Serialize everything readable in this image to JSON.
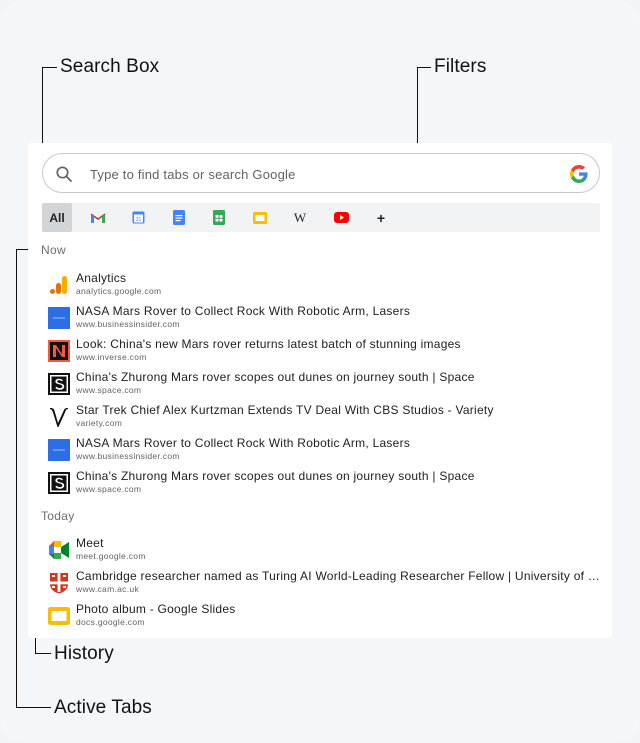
{
  "callouts": {
    "search_box": "Search Box",
    "filters": "Filters",
    "history": "History",
    "active_tabs": "Active Tabs"
  },
  "search": {
    "placeholder": "Type to find tabs or search Google"
  },
  "filters": {
    "all_label": "All",
    "add_label": "+",
    "wikipedia_letter": "W",
    "chips": [
      "gmail-icon",
      "calendar-icon",
      "docs-icon",
      "sheets-icon",
      "slides-icon",
      "wikipedia-icon",
      "youtube-icon"
    ]
  },
  "sections": {
    "now": "Now",
    "today": "Today"
  },
  "now_items": [
    {
      "title": "Analytics",
      "url": "analytics.google.com",
      "icon": "analytics-icon"
    },
    {
      "title": "NASA Mars Rover to Collect Rock With Robotic Arm, Lasers",
      "url": "www.businessinsider.com",
      "icon": "business-insider-icon"
    },
    {
      "title": "Look: China's new Mars rover returns latest batch of stunning images",
      "url": "www.inverse.com",
      "icon": "inverse-icon"
    },
    {
      "title": "China's Zhurong Mars rover scopes out dunes on journey south | Space",
      "url": "www.space.com",
      "icon": "space-icon"
    },
    {
      "title": "Star Trek Chief Alex Kurtzman Extends TV Deal With CBS Studios - Variety",
      "url": "variety.com",
      "icon": "variety-icon"
    },
    {
      "title": "NASA Mars Rover to Collect Rock With Robotic Arm, Lasers",
      "url": "www.businessinsider.com",
      "icon": "business-insider-icon"
    },
    {
      "title": "China's Zhurong Mars rover scopes out dunes on journey south | Space",
      "url": "www.space.com",
      "icon": "space-icon"
    }
  ],
  "today_items": [
    {
      "title": "Meet",
      "url": "meet.google.com",
      "icon": "meet-icon"
    },
    {
      "title": "Cambridge researcher named as Turing AI World-Leading Researcher Fellow | University of Cambridge",
      "url": "www.cam.ac.uk",
      "icon": "cambridge-icon"
    },
    {
      "title": "Photo album - Google Slides",
      "url": "docs.google.com",
      "icon": "slides-icon"
    }
  ],
  "colors": {
    "background": "#f3f7fa",
    "panel": "#ffffff",
    "filter_bar": "#f1f3f4",
    "filter_selected": "#d2d5d8",
    "google_blue": "#4285f4",
    "google_red": "#ea4335",
    "google_yellow": "#fbbc04",
    "google_green": "#34a853"
  }
}
